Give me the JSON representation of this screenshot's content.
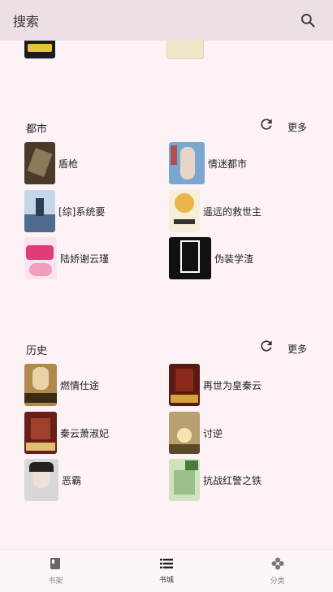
{
  "search": {
    "label": "搜索"
  },
  "sections": [
    {
      "title": "都市",
      "more_label": "更多",
      "books": [
        {
          "name": "盾枪",
          "color": "#4a3a2a"
        },
        {
          "name": "情迷都市",
          "color": "#7aa7cf"
        },
        {
          "name": "[综]系统要",
          "color": "#6c8db5"
        },
        {
          "name": "遥远的救世主",
          "color": "#e8c96a"
        },
        {
          "name": "陆娇谢云瑾",
          "color": "#f2a9c8"
        },
        {
          "name": "伪装学渣",
          "color": "#111111"
        }
      ]
    },
    {
      "title": "历史",
      "more_label": "更多",
      "books": [
        {
          "name": "燃情仕途",
          "color": "#b08a4a"
        },
        {
          "name": "再世为皇秦云",
          "color": "#5a1a14"
        },
        {
          "name": "秦云萧淑妃",
          "color": "#6a1e18"
        },
        {
          "name": "讨逆",
          "color": "#b8a070"
        },
        {
          "name": "恶霸",
          "color": "#c9c9c9"
        },
        {
          "name": "抗战红警之铁",
          "color": "#9bbf8a"
        }
      ]
    }
  ],
  "bottom_tabs": [
    {
      "label": "书架",
      "icon": "book-icon"
    },
    {
      "label": "书城",
      "icon": "list-icon"
    },
    {
      "label": "分类",
      "icon": "category-icon"
    }
  ]
}
